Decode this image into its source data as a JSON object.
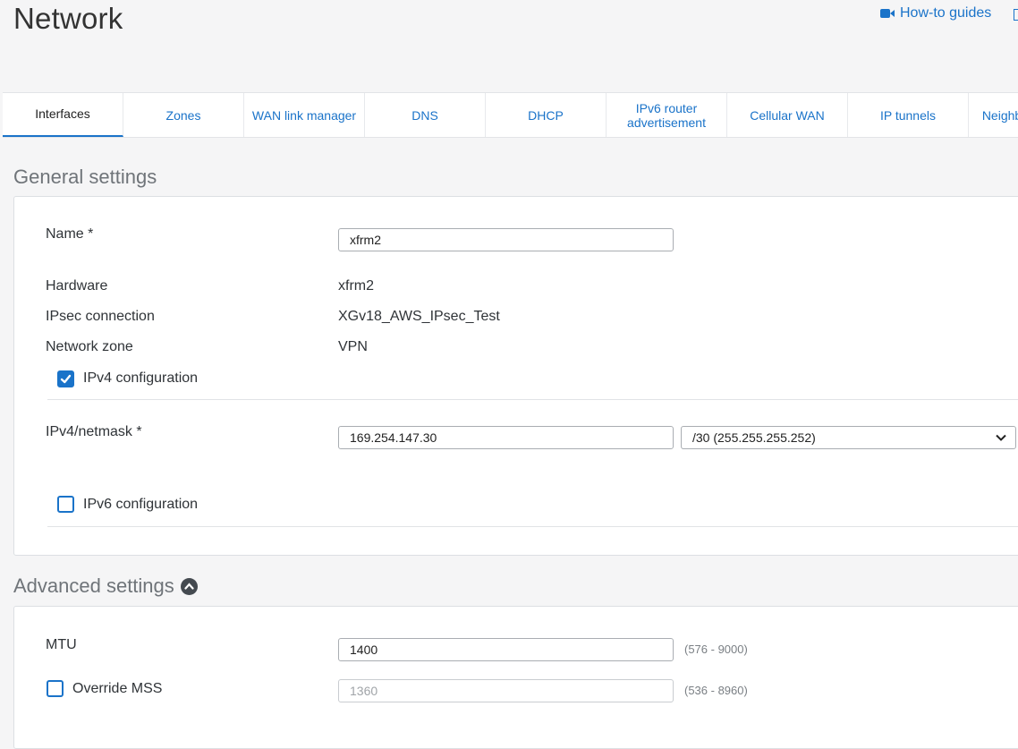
{
  "page": {
    "title": "Network"
  },
  "header": {
    "howto_label": "How-to guides"
  },
  "tabs": [
    {
      "label": "Interfaces",
      "active": true
    },
    {
      "label": "Zones"
    },
    {
      "label": "WAN link manager"
    },
    {
      "label": "DNS"
    },
    {
      "label": "DHCP"
    },
    {
      "label": "IPv6 router advertisement"
    },
    {
      "label": "Cellular WAN"
    },
    {
      "label": "IP tunnels"
    },
    {
      "label": "Neighb N"
    }
  ],
  "general": {
    "title": "General settings",
    "name_label": "Name *",
    "name_value": "xfrm2",
    "hardware_label": "Hardware",
    "hardware_value": "xfrm2",
    "ipsec_label": "IPsec connection",
    "ipsec_value": "XGv18_AWS_IPsec_Test",
    "zone_label": "Network zone",
    "zone_value": "VPN",
    "ipv4_config_label": "IPv4 configuration",
    "ipv4_config_checked": true,
    "ipv4_netmask_label": "IPv4/netmask *",
    "ipv4_value": "169.254.147.30",
    "netmask_value": "/30 (255.255.255.252)",
    "ipv6_config_label": "IPv6 configuration",
    "ipv6_config_checked": false
  },
  "advanced": {
    "title": "Advanced settings",
    "mtu_label": "MTU",
    "mtu_value": "1400",
    "mtu_range": "(576 - 9000)",
    "mss_label": "Override MSS",
    "mss_checked": false,
    "mss_value": "1360",
    "mss_range": "(536 - 8960)"
  },
  "colors": {
    "accent": "#1a73c9",
    "background": "#f5f5f6"
  }
}
